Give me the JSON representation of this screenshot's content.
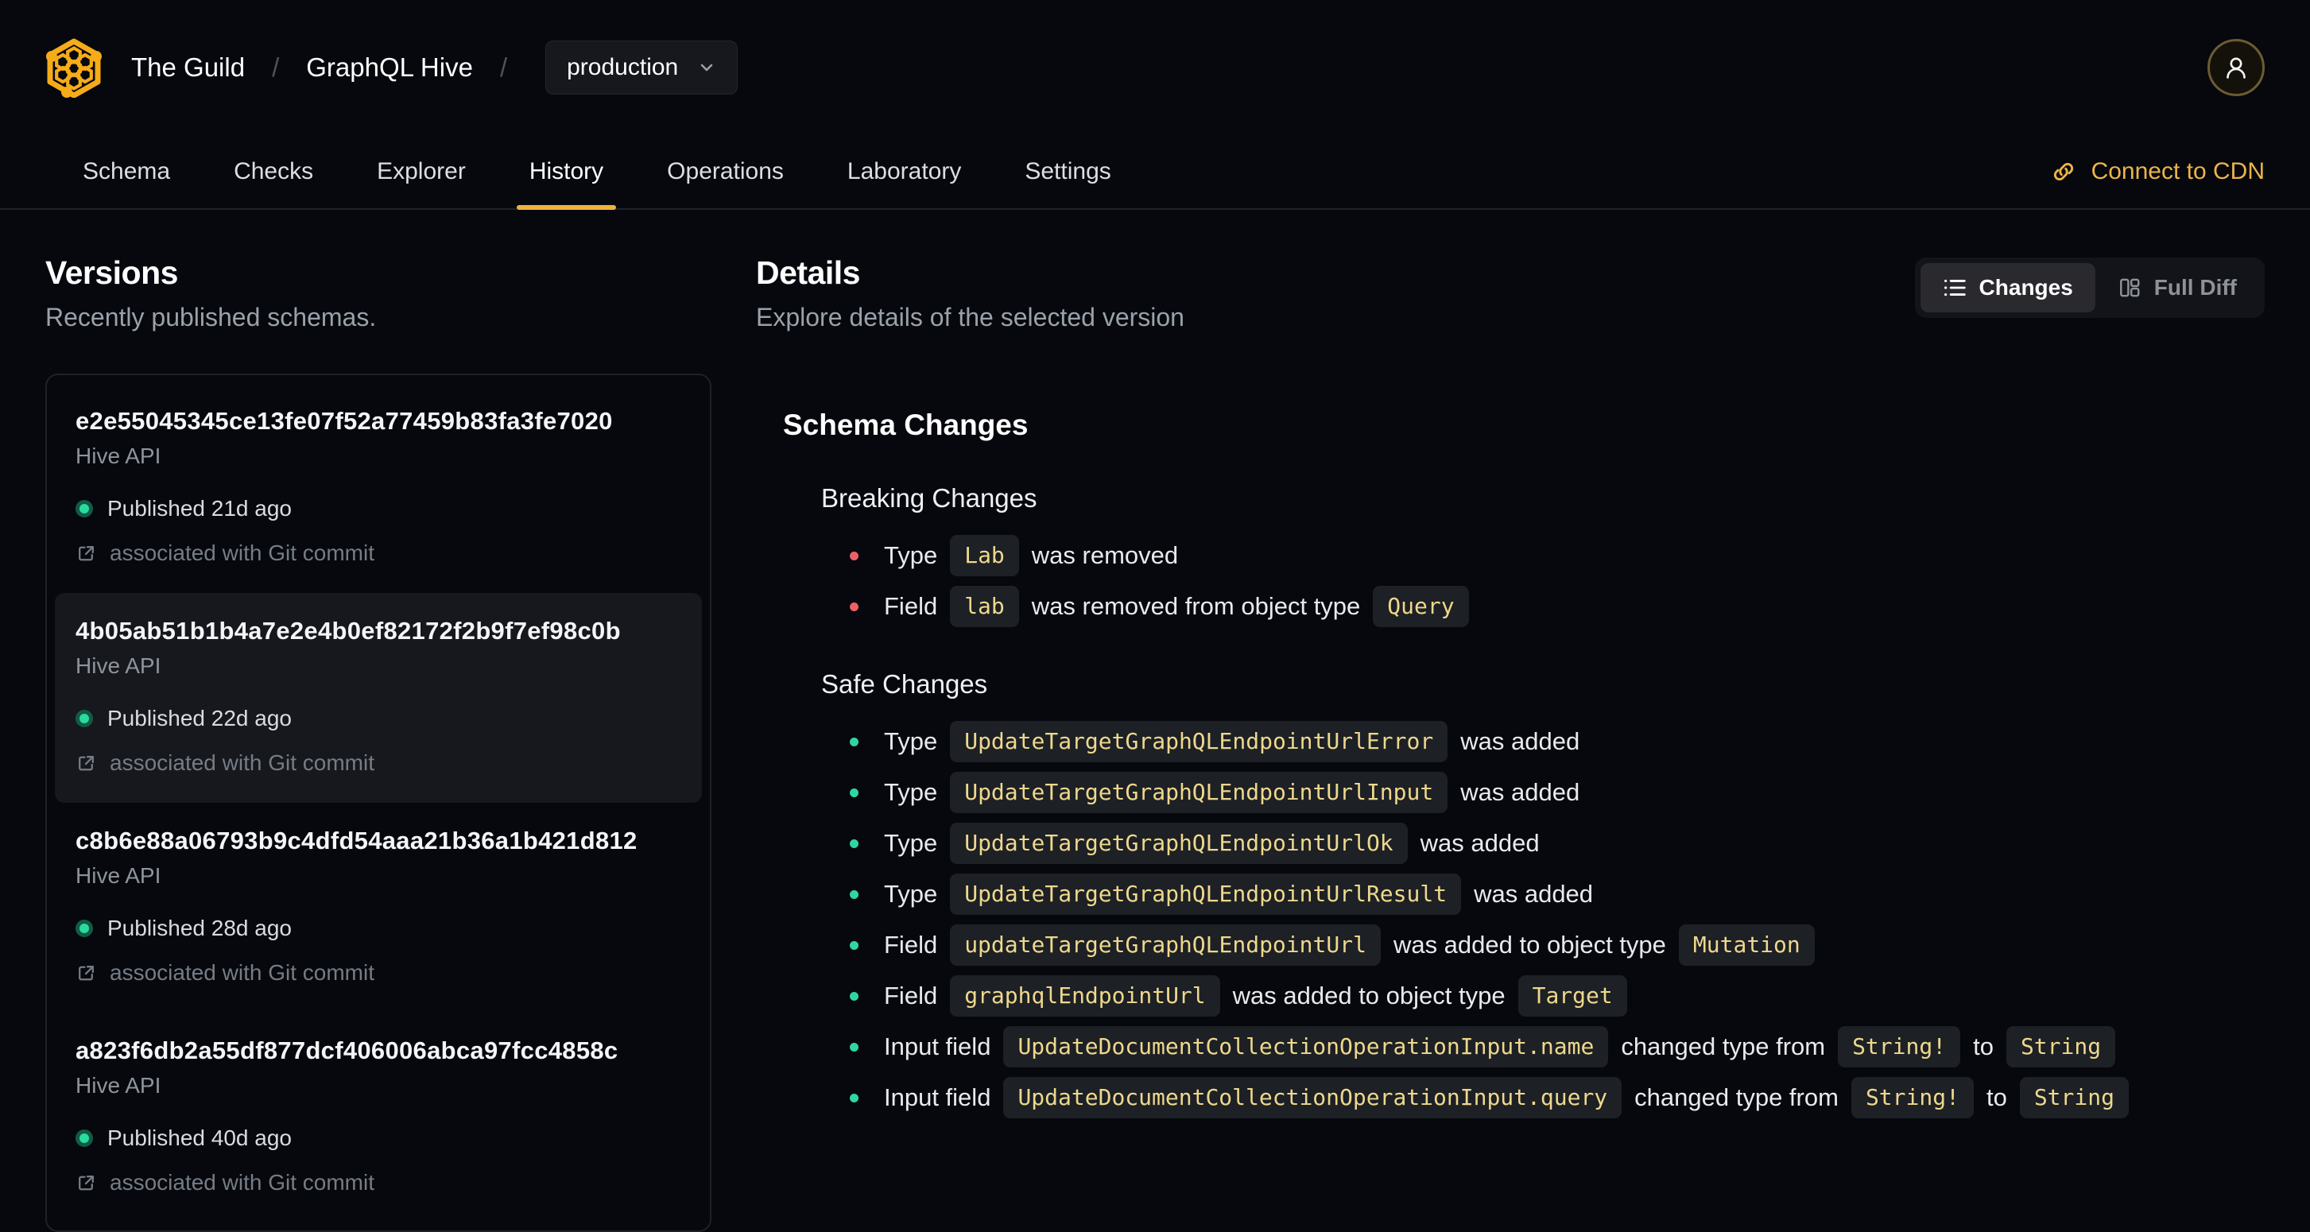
{
  "header": {
    "org": "The Guild",
    "project": "GraphQL Hive",
    "target": "production",
    "separator": "/"
  },
  "nav": {
    "tabs": [
      "Schema",
      "Checks",
      "Explorer",
      "History",
      "Operations",
      "Laboratory",
      "Settings"
    ],
    "active_tab": "History",
    "cdn_link": "Connect to CDN"
  },
  "versions": {
    "title": "Versions",
    "subtitle": "Recently published schemas.",
    "items": [
      {
        "hash": "e2e55045345ce13fe07f52a77459b83fa3fe7020",
        "service": "Hive API",
        "status": "Published 21d ago",
        "git": "associated with Git commit",
        "selected": false
      },
      {
        "hash": "4b05ab51b1b4a7e2e4b0ef82172f2b9f7ef98c0b",
        "service": "Hive API",
        "status": "Published 22d ago",
        "git": "associated with Git commit",
        "selected": true
      },
      {
        "hash": "c8b6e88a06793b9c4dfd54aaa21b36a1b421d812",
        "service": "Hive API",
        "status": "Published 28d ago",
        "git": "associated with Git commit",
        "selected": false
      },
      {
        "hash": "a823f6db2a55df877dcf406006abca97fcc4858c",
        "service": "Hive API",
        "status": "Published 40d ago",
        "git": "associated with Git commit",
        "selected": false
      }
    ]
  },
  "details": {
    "title": "Details",
    "subtitle": "Explore details of the selected version",
    "toggle": {
      "changes_label": "Changes",
      "full_diff_label": "Full Diff",
      "selected": "Changes"
    },
    "schema_changes_title": "Schema Changes",
    "groups": [
      {
        "title": "Breaking Changes",
        "severity": "breaking",
        "bullet_color": "#ee6067",
        "items": [
          [
            {
              "t": "text",
              "v": "Type"
            },
            {
              "t": "code",
              "v": "Lab"
            },
            {
              "t": "text",
              "v": "was removed"
            }
          ],
          [
            {
              "t": "text",
              "v": "Field"
            },
            {
              "t": "code",
              "v": "lab"
            },
            {
              "t": "text",
              "v": "was removed from object type"
            },
            {
              "t": "code",
              "v": "Query"
            }
          ]
        ]
      },
      {
        "title": "Safe Changes",
        "severity": "safe",
        "bullet_color": "#30d6a0",
        "items": [
          [
            {
              "t": "text",
              "v": "Type"
            },
            {
              "t": "code",
              "v": "UpdateTargetGraphQLEndpointUrlError"
            },
            {
              "t": "text",
              "v": "was added"
            }
          ],
          [
            {
              "t": "text",
              "v": "Type"
            },
            {
              "t": "code",
              "v": "UpdateTargetGraphQLEndpointUrlInput"
            },
            {
              "t": "text",
              "v": "was added"
            }
          ],
          [
            {
              "t": "text",
              "v": "Type"
            },
            {
              "t": "code",
              "v": "UpdateTargetGraphQLEndpointUrlOk"
            },
            {
              "t": "text",
              "v": "was added"
            }
          ],
          [
            {
              "t": "text",
              "v": "Type"
            },
            {
              "t": "code",
              "v": "UpdateTargetGraphQLEndpointUrlResult"
            },
            {
              "t": "text",
              "v": "was added"
            }
          ],
          [
            {
              "t": "text",
              "v": "Field"
            },
            {
              "t": "code",
              "v": "updateTargetGraphQLEndpointUrl"
            },
            {
              "t": "text",
              "v": "was added to object type"
            },
            {
              "t": "code",
              "v": "Mutation"
            }
          ],
          [
            {
              "t": "text",
              "v": "Field"
            },
            {
              "t": "code",
              "v": "graphqlEndpointUrl"
            },
            {
              "t": "text",
              "v": "was added to object type"
            },
            {
              "t": "code",
              "v": "Target"
            }
          ],
          [
            {
              "t": "text",
              "v": "Input field"
            },
            {
              "t": "code",
              "v": "UpdateDocumentCollectionOperationInput.name"
            },
            {
              "t": "text",
              "v": "changed type from"
            },
            {
              "t": "code",
              "v": "String!"
            },
            {
              "t": "text",
              "v": "to"
            },
            {
              "t": "code",
              "v": "String"
            }
          ],
          [
            {
              "t": "text",
              "v": "Input field"
            },
            {
              "t": "code",
              "v": "UpdateDocumentCollectionOperationInput.query"
            },
            {
              "t": "text",
              "v": "changed type from"
            },
            {
              "t": "code",
              "v": "String!"
            },
            {
              "t": "text",
              "v": "to"
            },
            {
              "t": "code",
              "v": "String"
            }
          ]
        ]
      }
    ]
  },
  "colors": {
    "background": "#06080e",
    "accent_amber": "#f0b13c",
    "cdn_link": "#edb449",
    "breaking_bullet": "#ee6067",
    "safe_bullet": "#30d6a0",
    "published_dot": "#2adb9d",
    "chip_background": "#1d2025",
    "chip_text": "#eed88c"
  },
  "icons": [
    "hive-logo",
    "chevron-down-icon",
    "user-icon",
    "link-icon",
    "external-link-icon",
    "list-icon",
    "columns-icon",
    "status-dot",
    "bullet-dot"
  ]
}
